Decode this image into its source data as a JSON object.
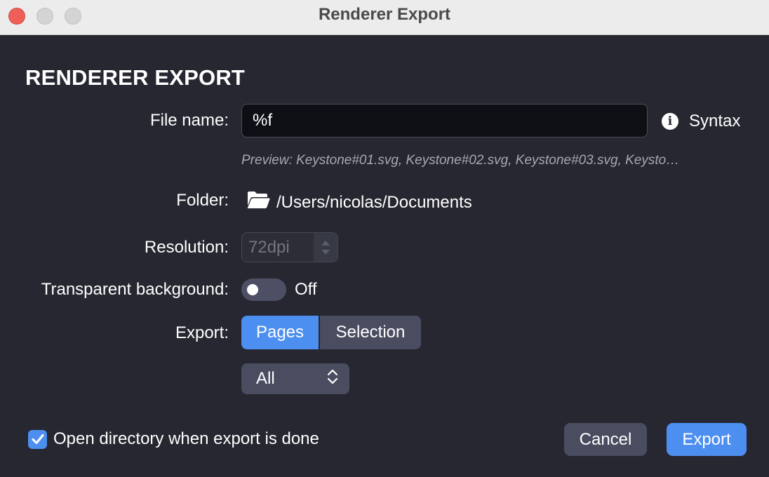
{
  "window": {
    "title": "Renderer Export"
  },
  "heading": "RENDERER EXPORT",
  "file_name": {
    "label": "File name:",
    "value": "%f",
    "syntax_label": "Syntax"
  },
  "preview": "Preview: Keystone#01.svg, Keystone#02.svg, Keystone#03.svg, Keysto…",
  "folder": {
    "label": "Folder:",
    "path": "/Users/nicolas/Documents"
  },
  "resolution": {
    "label": "Resolution:",
    "value": "72dpi"
  },
  "transparent_background": {
    "label": "Transparent background:",
    "state": "Off"
  },
  "export_mode": {
    "label": "Export:",
    "options": [
      "Pages",
      "Selection"
    ],
    "selected": "Pages"
  },
  "pages_select": {
    "value": "All"
  },
  "open_directory": {
    "label": "Open directory when export is done",
    "checked": true
  },
  "buttons": {
    "cancel": "Cancel",
    "export": "Export"
  },
  "colors": {
    "accent": "#4d8ff0",
    "background": "#262730",
    "secondary_button": "#4a4d60"
  },
  "icons": {
    "info": "info-icon",
    "folder": "folder-open-icon",
    "select": "chevron-up-down-icon",
    "checkbox": "checkmark-icon"
  }
}
